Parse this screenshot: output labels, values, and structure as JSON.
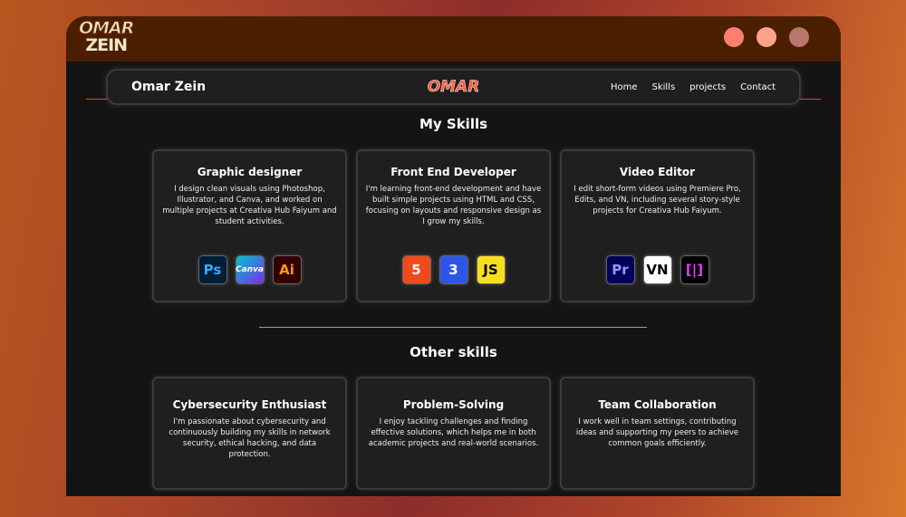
{
  "window": {
    "logo_top": "OMAR",
    "logo_bottom": "ZEIN",
    "dot_colors": [
      "#ff7f6e",
      "#ffa28c",
      "#b9766c"
    ]
  },
  "nav": {
    "brand": "Omar Zein",
    "center_logo": "OMAR",
    "links": [
      "Home",
      "Skills",
      "projects",
      "Contact"
    ]
  },
  "skills": {
    "title": "My Skills",
    "cards": [
      {
        "title": "Graphic designer",
        "text": "I design clean visuals using Photoshop, Illustrator, and Canva, and worked on multiple projects at Creativa Hub Faiyum and student activities.",
        "icons": [
          {
            "name": "photoshop-icon",
            "label": "Ps",
            "bg": "#001e36",
            "fg": "#31a8ff"
          },
          {
            "name": "canva-icon",
            "label": "Canva",
            "bg": "#7d2ae8",
            "fg": "#fff"
          },
          {
            "name": "illustrator-icon",
            "label": "Ai",
            "bg": "#330000",
            "fg": "#ff9a00"
          }
        ]
      },
      {
        "title": "Front End Developer",
        "text": "I'm learning front-end development and have built simple projects using HTML and CSS, focusing on layouts and responsive design as I grow my skills.",
        "icons": [
          {
            "name": "html5-icon",
            "label": "5",
            "bg": "#f14a1a",
            "fg": "#fff"
          },
          {
            "name": "css3-icon",
            "label": "3",
            "bg": "#2d55e6",
            "fg": "#fff"
          },
          {
            "name": "javascript-icon",
            "label": "JS",
            "bg": "#f7df1e",
            "fg": "#000"
          }
        ]
      },
      {
        "title": "Video Editor",
        "text": "I edit short-form videos using Premiere Pro, Edits, and VN, including several story-style projects for Creativa Hub Faiyum.",
        "icons": [
          {
            "name": "premiere-icon",
            "label": "Pr",
            "bg": "#00005b",
            "fg": "#9999ff"
          },
          {
            "name": "vn-icon",
            "label": "VN",
            "bg": "#ffffff",
            "fg": "#000"
          },
          {
            "name": "edits-icon",
            "label": "[|]",
            "bg": "#000",
            "fg": "#e040fb"
          }
        ]
      }
    ]
  },
  "other": {
    "title": "Other skills",
    "cards": [
      {
        "title": "Cybersecurity Enthusiast",
        "text": "I'm passionate about cybersecurity and continuously building my skills in network security, ethical hacking, and data protection."
      },
      {
        "title": "Problem-Solving",
        "text": "I enjoy tackling challenges and finding effective solutions, which helps me in both academic projects and real-world scenarios."
      },
      {
        "title": "Team Collaboration",
        "text": "I work well in team settings, contributing ideas and supporting my peers to achieve common goals efficiently."
      }
    ]
  }
}
